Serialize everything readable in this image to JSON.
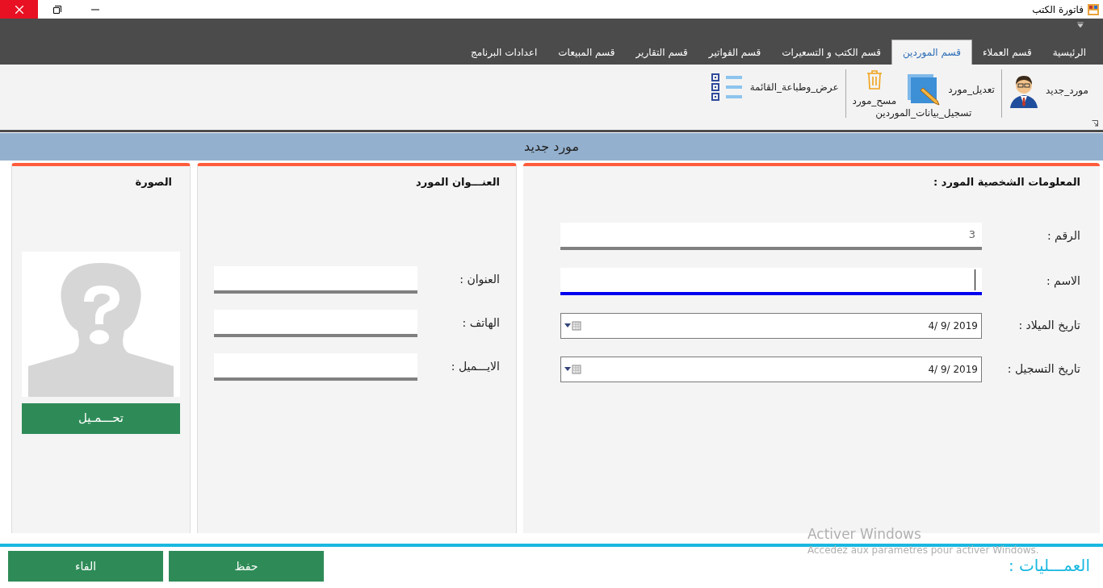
{
  "window": {
    "title": "فاتورة الكتب"
  },
  "tabs": [
    {
      "label": "الرئيسية",
      "selected": false
    },
    {
      "label": "قسم العملاء",
      "selected": false
    },
    {
      "label": "قسم الموردين",
      "selected": true
    },
    {
      "label": "قسم الكتب و التسعيرات",
      "selected": false
    },
    {
      "label": "قسم الفواتير",
      "selected": false
    },
    {
      "label": "قسم التقارير",
      "selected": false
    },
    {
      "label": "قسم المبيعات",
      "selected": false
    },
    {
      "label": "اعدادات البرنامج",
      "selected": false
    }
  ],
  "ribbon": {
    "groups": [
      {
        "buttons": [
          {
            "label": "مورد_جديد",
            "kind": "large"
          }
        ]
      },
      {
        "label": "تسجيل_بيانات_الموردين",
        "buttons": [
          {
            "label": "تعديل_مورد",
            "kind": "large"
          },
          {
            "label": "مسح_مورد",
            "kind": "stacked"
          }
        ]
      },
      {
        "buttons": [
          {
            "label": "عرض_وطباعة_القائمة",
            "kind": "inline"
          }
        ]
      }
    ]
  },
  "form_header": "مورد جديد",
  "personal_panel": {
    "title": "المعلومات الشخصية المورد :",
    "fields": [
      {
        "label": "الرقم :",
        "value": "3",
        "kind": "text",
        "focused": false
      },
      {
        "label": "الاسم :",
        "kind": "text",
        "focused": true
      },
      {
        "label": "تاريخ الميلاد :",
        "value": "4/  9/ 2019",
        "kind": "date",
        "focused": false
      },
      {
        "label": "تاريخ التسجيل :",
        "value": "4/  9/ 2019",
        "kind": "date",
        "focused": false
      }
    ]
  },
  "address_panel": {
    "title": "العنـــوان المورد",
    "fields": [
      {
        "label": "العنوان :",
        "kind": "text",
        "focused": false
      },
      {
        "label": "الهاتف :",
        "kind": "text",
        "focused": false
      },
      {
        "label": "الايـــميل :",
        "kind": "text",
        "focused": false
      }
    ]
  },
  "photo_panel": {
    "title": "الصورة",
    "button": "تحـــمـيل"
  },
  "operations": {
    "label": "العمـــليات :",
    "buttons": [
      "حفظ",
      "الفاء"
    ]
  },
  "activation_notice": {
    "title": "Activer Windows",
    "text": "Accedez aux parametres pour activer Windows."
  }
}
